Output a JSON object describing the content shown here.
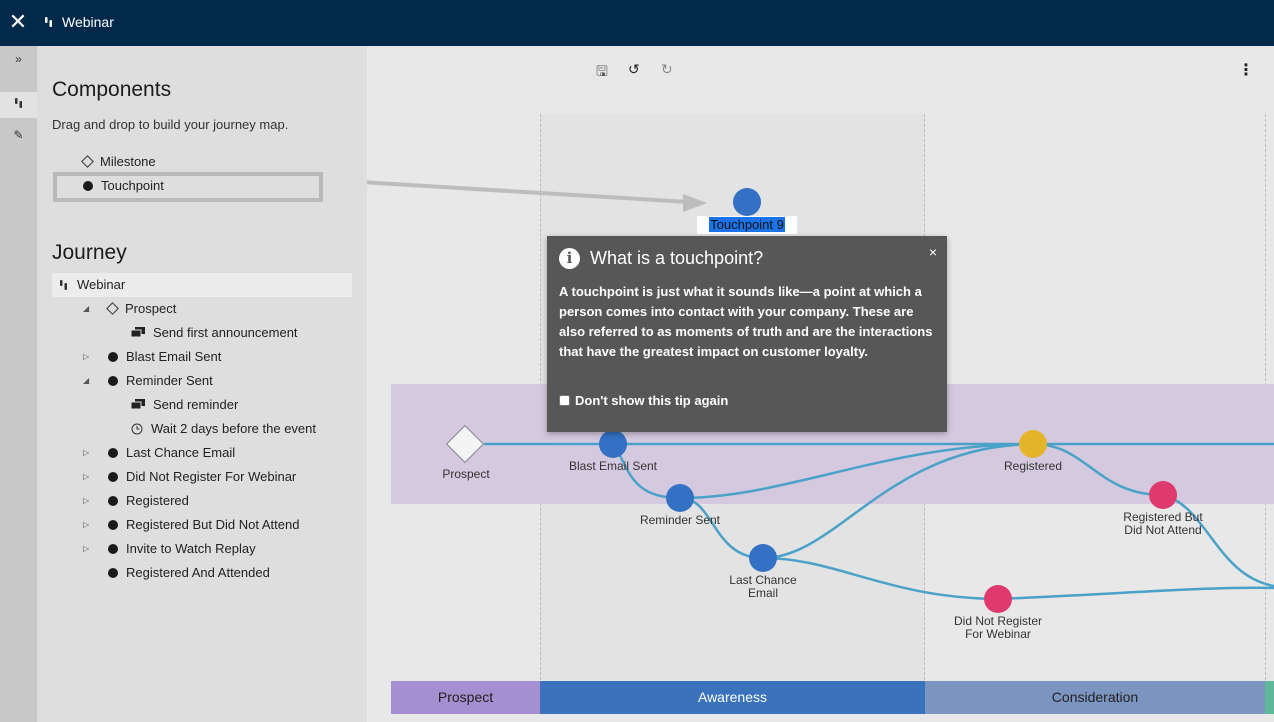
{
  "topbar": {
    "close_glyph": "✕",
    "title": "Webinar",
    "journey_icon": "footsteps-icon"
  },
  "rail": {
    "expand_glyph": "»",
    "journey_glyph": "ꟾ",
    "edit_glyph": "✎"
  },
  "components": {
    "heading": "Components",
    "hint": "Drag and drop to build your journey map.",
    "items": [
      {
        "label": "Milestone",
        "icon": "diamond-icon"
      },
      {
        "label": "Touchpoint",
        "icon": "dot-icon"
      }
    ]
  },
  "journey": {
    "heading": "Journey",
    "root": "Webinar",
    "items": [
      {
        "label": "Prospect",
        "icon": "diamond-icon",
        "expanded": true
      },
      {
        "label": "Send first announcement",
        "icon": "message-icon",
        "child": true
      },
      {
        "label": "Blast Email Sent",
        "icon": "dot-icon",
        "expanded": false
      },
      {
        "label": "Reminder Sent",
        "icon": "dot-icon",
        "expanded": true
      },
      {
        "label": "Send reminder",
        "icon": "message-icon",
        "child": true
      },
      {
        "label": "Wait 2 days before the event",
        "icon": "clock-icon",
        "child": true
      },
      {
        "label": "Last Chance Email",
        "icon": "dot-icon",
        "expanded": false
      },
      {
        "label": "Did Not Register For Webinar",
        "icon": "dot-icon",
        "expanded": false
      },
      {
        "label": "Registered",
        "icon": "dot-icon",
        "expanded": false
      },
      {
        "label": "Registered But Did Not Attend",
        "icon": "dot-icon",
        "expanded": false
      },
      {
        "label": "Invite to Watch Replay",
        "icon": "dot-icon",
        "expanded": false
      },
      {
        "label": "Registered And Attended",
        "icon": "dot-icon",
        "leaf": true
      }
    ]
  },
  "toolbar": {
    "save_glyph": "🖫",
    "undo_glyph": "↺",
    "redo_glyph": "↻",
    "menu_glyph": "⋮"
  },
  "canvas": {
    "new_touchpoint": "Touchpoint 9",
    "nodes": [
      {
        "id": "prospect",
        "label": "Prospect"
      },
      {
        "id": "blast",
        "label": "Blast Email Sent"
      },
      {
        "id": "reminder",
        "label": "Reminder Sent"
      },
      {
        "id": "lastchance",
        "label": "Last Chance Email"
      },
      {
        "id": "registered",
        "label": "Registered"
      },
      {
        "id": "rbdna",
        "label": "Registered But Did Not Attend"
      },
      {
        "id": "dnr",
        "label": "Did Not Register For Webinar"
      }
    ],
    "stages": [
      {
        "label": "Prospect",
        "color": "#a58fd0",
        "text": "#222222"
      },
      {
        "label": "Awareness",
        "color": "#3a72bc",
        "text": "#ffffff"
      },
      {
        "label": "Consideration",
        "color": "#7b95c0",
        "text": "#222222"
      }
    ],
    "colors": {
      "touchpoint": "#3471c4",
      "registered": "#e4b52a",
      "negative": "#de3a6e",
      "path": "#4aa2c9"
    }
  },
  "tooltip": {
    "title": "What is a touchpoint?",
    "close_glyph": "×",
    "body": "A touchpoint is just what it sounds like—a point at which a person comes into contact with your company. These are also referred to as moments of truth and are the interactions that have the greatest impact on customer loyalty.",
    "checkbox_label": "Don't show this tip again"
  }
}
